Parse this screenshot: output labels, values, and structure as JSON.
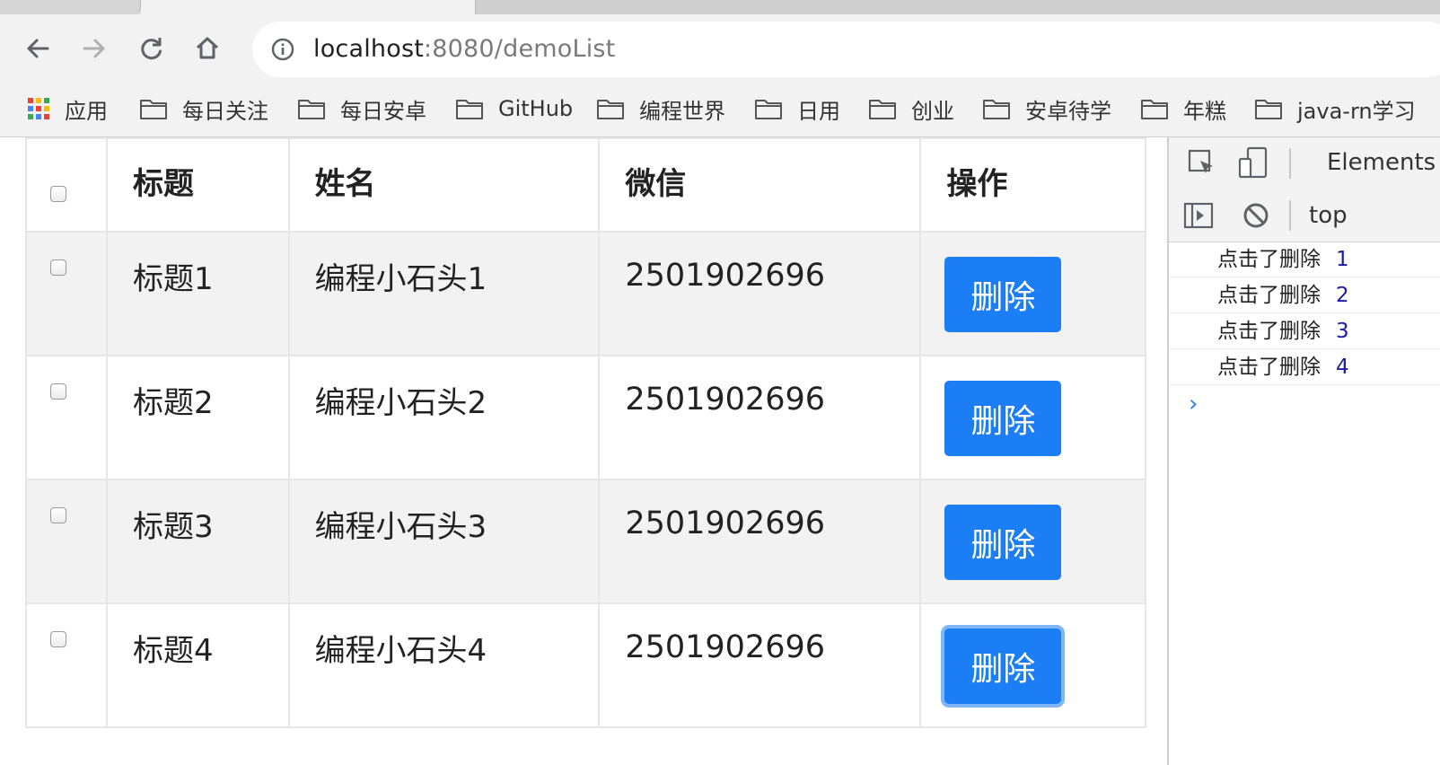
{
  "browser": {
    "url_host": "localhost",
    "url_path": ":8080/demoList",
    "bookmarks": [
      {
        "label": "应用",
        "icon": "apps-grid-icon"
      },
      {
        "label": "每日关注",
        "icon": "folder-icon"
      },
      {
        "label": "每日安卓",
        "icon": "folder-icon"
      },
      {
        "label": "GitHub",
        "icon": "folder-icon"
      },
      {
        "label": "编程世界",
        "icon": "folder-icon"
      },
      {
        "label": "日用",
        "icon": "folder-icon"
      },
      {
        "label": "创业",
        "icon": "folder-icon"
      },
      {
        "label": "安卓待学",
        "icon": "folder-icon"
      },
      {
        "label": "年糕",
        "icon": "folder-icon"
      },
      {
        "label": "java-rn学习",
        "icon": "folder-icon"
      }
    ],
    "nav_icons": [
      "back-icon",
      "forward-icon",
      "reload-icon",
      "home-icon"
    ]
  },
  "table": {
    "headers": {
      "title": "标题",
      "name": "姓名",
      "wechat": "微信",
      "action": "操作"
    },
    "rows": [
      {
        "title": "标题1",
        "name": "编程小石头1",
        "wechat": "2501902696",
        "action": "删除"
      },
      {
        "title": "标题2",
        "name": "编程小石头2",
        "wechat": "2501902696",
        "action": "删除"
      },
      {
        "title": "标题3",
        "name": "编程小石头3",
        "wechat": "2501902696",
        "action": "删除"
      },
      {
        "title": "标题4",
        "name": "编程小石头4",
        "wechat": "2501902696",
        "action": "删除"
      }
    ],
    "colors": {
      "button": "#1b7ef5",
      "stripe": "#f2f2f2"
    }
  },
  "devtools": {
    "tab_label": "Elements",
    "context": "top",
    "console": [
      {
        "message": "点击了删除",
        "value": "1"
      },
      {
        "message": "点击了删除",
        "value": "2"
      },
      {
        "message": "点击了删除",
        "value": "3"
      },
      {
        "message": "点击了删除",
        "value": "4"
      }
    ],
    "prompt": "›"
  }
}
